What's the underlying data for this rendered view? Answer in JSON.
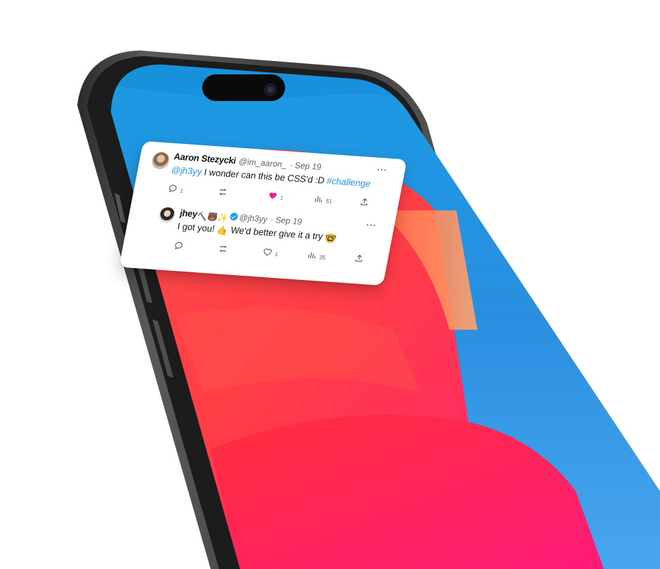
{
  "tweets": [
    {
      "author": "Aaron Stezycki",
      "handle": "@im_aaron_",
      "date": "· Sep 19",
      "mention": "@jh3yy",
      "text": " I wonder can this be CSS'd :D ",
      "hashtag": "#challenge",
      "more": "···",
      "stats": {
        "replies": "1",
        "reposts": "",
        "likes": "1",
        "views": "51"
      },
      "liked": true
    },
    {
      "author": "jhey",
      "author_emoji": "🔨🐻✨",
      "handle": "@jh3yy",
      "date": "· Sep 19",
      "text_a": "I got you! ",
      "emoji_a": "🤙",
      "text_b": " We'd better give it a try ",
      "emoji_b": "🤓",
      "more": "···",
      "stats": {
        "replies": "",
        "reposts": "",
        "likes": "1",
        "views": "35"
      },
      "verified": true
    }
  ],
  "icons": [
    "reply-icon",
    "repost-icon",
    "like-icon",
    "views-icon",
    "share-icon",
    "verified-badge-icon",
    "camera-icon"
  ],
  "colors": {
    "accent": "#1d9bf0",
    "like": "#f91880",
    "text": "#0f1419",
    "muted": "#536471"
  }
}
